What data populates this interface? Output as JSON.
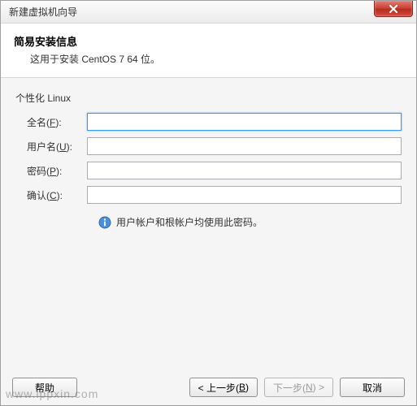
{
  "window": {
    "title": "新建虚拟机向导"
  },
  "header": {
    "title": "简易安装信息",
    "subtitle": "这用于安装 CentOS 7 64 位。"
  },
  "group": {
    "label": "个性化 Linux"
  },
  "form": {
    "fullname": {
      "label_pre": "全名(",
      "key": "F",
      "label_post": "):",
      "value": ""
    },
    "username": {
      "label_pre": "用户名(",
      "key": "U",
      "label_post": "):",
      "value": ""
    },
    "password": {
      "label_pre": "密码(",
      "key": "P",
      "label_post": "):",
      "value": ""
    },
    "confirm": {
      "label_pre": "确认(",
      "key": "C",
      "label_post": "):",
      "value": ""
    }
  },
  "info": {
    "text": "用户帐户和根帐户均使用此密码。"
  },
  "footer": {
    "help": "帮助",
    "back_pre": "< 上一步(",
    "back_key": "B",
    "back_post": ")",
    "next_pre": "下一步(",
    "next_key": "N",
    "next_post": ") >",
    "cancel": "取消"
  },
  "watermark": "www.lppxin.com"
}
